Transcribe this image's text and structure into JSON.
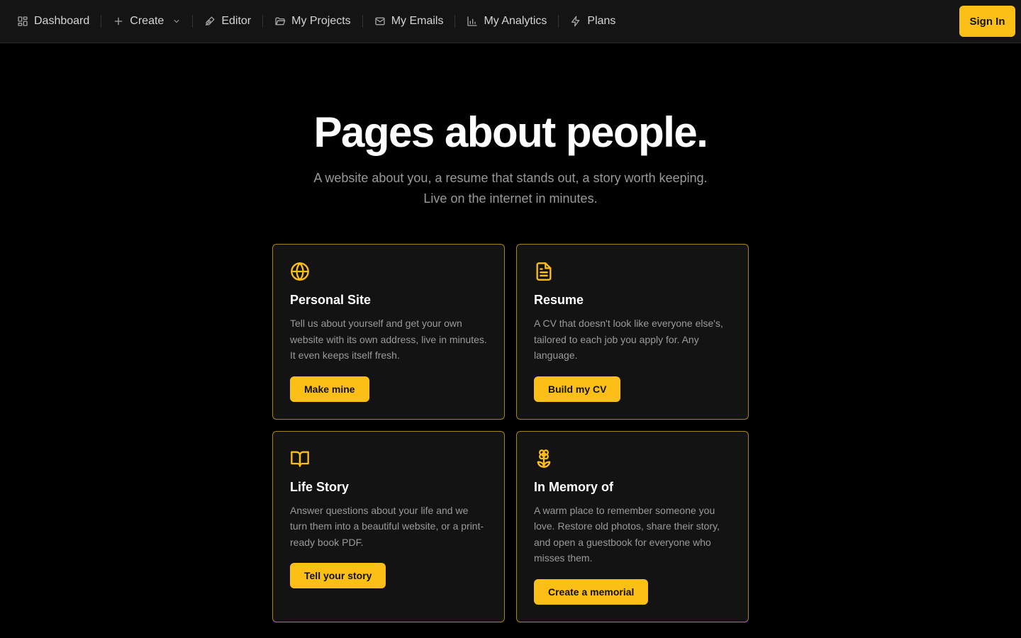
{
  "nav": {
    "items": [
      {
        "label": "Dashboard",
        "icon": "dashboard-icon"
      },
      {
        "label": "Create",
        "icon": "plus-icon"
      },
      {
        "label": "Editor",
        "icon": "pen-icon"
      },
      {
        "label": "My Projects",
        "icon": "folder-icon"
      },
      {
        "label": "My Emails",
        "icon": "mail-icon"
      },
      {
        "label": "My Analytics",
        "icon": "bar-chart-icon"
      },
      {
        "label": "Plans",
        "icon": "zap-icon"
      }
    ],
    "sign_in_label": "Sign In"
  },
  "hero": {
    "title": "Pages about people.",
    "subtitle_line1": "A website about you, a resume that stands out, a story worth keeping.",
    "subtitle_line2": "Live on the internet in minutes."
  },
  "cards": [
    {
      "title": "Personal Site",
      "description": "Tell us about yourself and get your own website with its own address, live in minutes. It even keeps itself fresh.",
      "cta": "Make mine",
      "icon": "globe-icon"
    },
    {
      "title": "Resume",
      "description": "A CV that doesn't look like everyone else's, tailored to each job you apply for. Any language.",
      "cta": "Build my CV",
      "icon": "document-icon"
    },
    {
      "title": "Life Story",
      "description": "Answer questions about your life and we turn them into a beautiful website, or a print-ready book PDF.",
      "cta": "Tell your story",
      "icon": "book-icon"
    },
    {
      "title": "In Memory of",
      "description": "A warm place to remember someone you love. Restore old photos, share their story, and open a guestbook for everyone who misses them.",
      "cta": "Create a memorial",
      "icon": "flower-icon"
    }
  ],
  "colors": {
    "accent": "#fbbf16",
    "background": "#000000",
    "card_background": "#131313",
    "card_border": "#a8841a",
    "nav_background": "#141414",
    "muted_text": "#9a9a9a"
  }
}
